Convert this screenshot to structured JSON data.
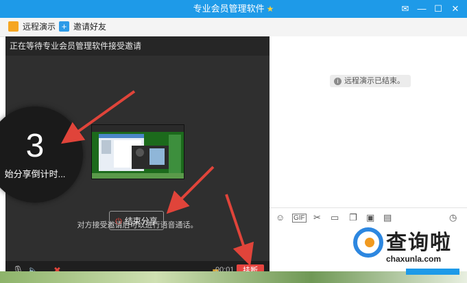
{
  "window": {
    "title": "专业会员管理软件",
    "controls": {
      "minimize": "—",
      "maximize": "☐",
      "close": "✕"
    }
  },
  "toolbar": {
    "remote_demo": "远程演示",
    "invite_friend": "邀请好友"
  },
  "share": {
    "header": "正在等待专业会员管理软件接受邀请",
    "hint": "对方接受邀请后可以进行语音通话。",
    "end_button": "结束分享",
    "timer": "00:01",
    "hangup": "挂断"
  },
  "countdown": {
    "number": "3",
    "label": "始分享倒计时..."
  },
  "right": {
    "notice": "远程演示已结束。"
  },
  "watermark": {
    "name": "查询啦",
    "url": "chaxunla.com"
  },
  "colors": {
    "titlebar": "#1e9ae8",
    "hangup": "#e64540",
    "arrow": "#e0443a"
  }
}
